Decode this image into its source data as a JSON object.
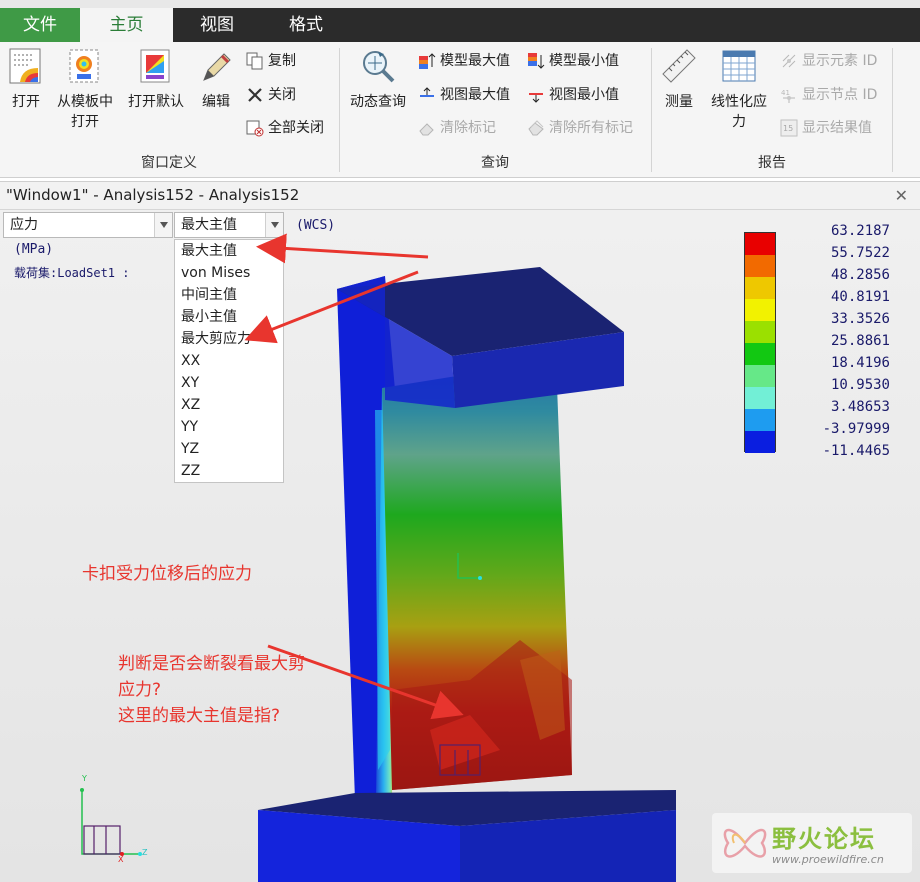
{
  "ribbon": {
    "tabs": [
      {
        "label": "文件"
      },
      {
        "label": "主页"
      },
      {
        "label": "视图"
      },
      {
        "label": "格式"
      }
    ],
    "groups": {
      "window_def": {
        "label": "窗口定义",
        "open": "打开",
        "open_template_line1": "从模板中",
        "open_template_line2": "打开",
        "open_default": "打开默认",
        "edit": "编辑",
        "copy": "复制",
        "close": "关闭",
        "close_all": "全部关闭"
      },
      "query": {
        "label": "查询",
        "dynamic_query": "动态查询",
        "model_max": "模型最大值",
        "model_min": "模型最小值",
        "view_max": "视图最大值",
        "view_min": "视图最小值",
        "clear_marks": "清除标记",
        "clear_all_marks": "清除所有标记"
      },
      "report": {
        "label": "报告",
        "measure": "测量",
        "linearize_line1": "线性化应",
        "linearize_line2": "力",
        "show_element_id": "显示元素 ID",
        "show_node_id": "显示节点 ID",
        "show_result_value": "显示结果值"
      }
    }
  },
  "window": {
    "title": "\"Window1\" - Analysis152 - Analysis152",
    "close_symbol": "✕"
  },
  "controls": {
    "quantity": "应力",
    "component": "最大主值",
    "component_options": [
      "最大主值",
      "von Mises",
      "中间主值",
      "最小主值",
      "最大剪应力",
      "XX",
      "XY",
      "XZ",
      "YY",
      "YZ",
      "ZZ"
    ]
  },
  "info": {
    "units": "(MPa)",
    "load_set": "载荷集:LoadSet1 :",
    "csys": "(WCS)"
  },
  "legend": {
    "values": [
      "63.2187",
      "55.7522",
      "48.2856",
      "40.8191",
      "33.3526",
      "25.8861",
      "18.4196",
      "10.9530",
      "3.48653",
      "-3.97999",
      "-11.4465"
    ],
    "colors": [
      "#e80000",
      "#f26a00",
      "#eec800",
      "#f2f200",
      "#9be000",
      "#12c812",
      "#66e888",
      "#72efd6",
      "#1e9cf0",
      "#0a1ee0",
      "#1a2580"
    ]
  },
  "annotations": {
    "note1": "卡扣受力位移后的应力",
    "note2_line1": "判断是否会断裂看最大剪",
    "note2_line2": "应力?",
    "note2_line3": "这里的最大主值是指?"
  },
  "triad": {
    "x": "X",
    "y": "Y",
    "z": "Z"
  },
  "watermark": {
    "title": "野火论坛",
    "url": "www.proewildfire.cn"
  },
  "accent_color": "#3f9a46",
  "annotation_color": "#e8352e"
}
